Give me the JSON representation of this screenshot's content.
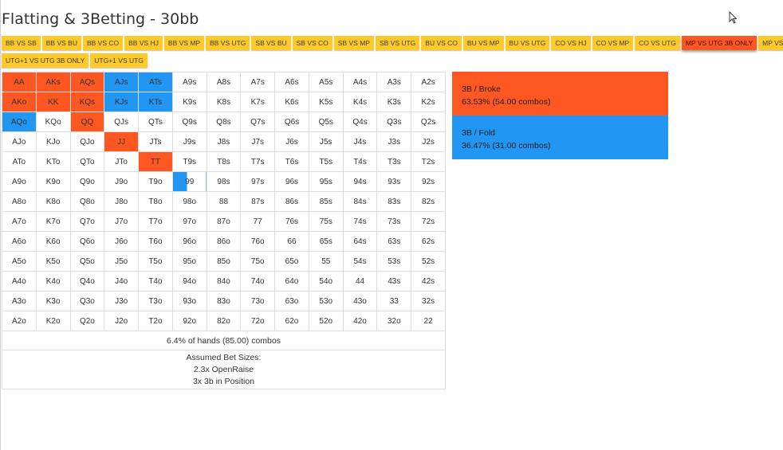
{
  "page": {
    "title": "Flatting & 3Betting - 30bb"
  },
  "tabs": {
    "row1": [
      "BB VS SB",
      "BB VS BU",
      "BB VS CO",
      "BB VS HJ",
      "BB VS MP",
      "BB VS UTG",
      "SB VS BU",
      "SB VS CO",
      "SB VS MP",
      "SB VS UTG",
      "BU VS CO",
      "BU VS MP",
      "BU VS UTG",
      "CO VS HJ",
      "CO VS MP",
      "CO VS UTG",
      "MP VS UTG 3B ONLY",
      "MP VS UTG"
    ],
    "row2": [
      "UTG+1 VS UTG 3B ONLY",
      "UTG+1 VS UTG"
    ],
    "active": "MP VS UTG 3B ONLY"
  },
  "colors": {
    "red": "#ff5722",
    "blue": "#2196f3",
    "tab": "#ffca28",
    "active_tab": "#ff5722"
  },
  "grid": [
    [
      "AA",
      "AKs",
      "AQs",
      "AJs",
      "ATs",
      "A9s",
      "A8s",
      "A7s",
      "A6s",
      "A5s",
      "A4s",
      "A3s",
      "A2s"
    ],
    [
      "AKo",
      "KK",
      "KQs",
      "KJs",
      "KTs",
      "K9s",
      "K8s",
      "K7s",
      "K6s",
      "K5s",
      "K4s",
      "K3s",
      "K2s"
    ],
    [
      "AQo",
      "KQo",
      "QQ",
      "QJs",
      "QTs",
      "Q9s",
      "Q8s",
      "Q7s",
      "Q6s",
      "Q5s",
      "Q4s",
      "Q3s",
      "Q2s"
    ],
    [
      "AJo",
      "KJo",
      "QJo",
      "JJ",
      "JTs",
      "J9s",
      "J8s",
      "J7s",
      "J6s",
      "J5s",
      "J4s",
      "J3s",
      "J2s"
    ],
    [
      "ATo",
      "KTo",
      "QTo",
      "JTo",
      "TT",
      "T9s",
      "T8s",
      "T7s",
      "T6s",
      "T5s",
      "T4s",
      "T3s",
      "T2s"
    ],
    [
      "A9o",
      "K9o",
      "Q9o",
      "J9o",
      "T9o",
      "99",
      "98s",
      "97s",
      "96s",
      "95s",
      "94s",
      "93s",
      "92s"
    ],
    [
      "A8o",
      "K8o",
      "Q8o",
      "J8o",
      "T8o",
      "98o",
      "88",
      "87s",
      "86s",
      "85s",
      "84s",
      "83s",
      "82s"
    ],
    [
      "A7o",
      "K7o",
      "Q7o",
      "J7o",
      "T7o",
      "97o",
      "87o",
      "77",
      "76s",
      "75s",
      "74s",
      "73s",
      "72s"
    ],
    [
      "A6o",
      "K6o",
      "Q6o",
      "J6o",
      "T6o",
      "96o",
      "86o",
      "76o",
      "66",
      "65s",
      "64s",
      "63s",
      "62s"
    ],
    [
      "A5o",
      "K5o",
      "Q5o",
      "J5o",
      "T5o",
      "95o",
      "85o",
      "75o",
      "65o",
      "55",
      "54s",
      "53s",
      "52s"
    ],
    [
      "A4o",
      "K4o",
      "Q4o",
      "J4o",
      "T4o",
      "94o",
      "84o",
      "74o",
      "64o",
      "54o",
      "44",
      "43s",
      "42s"
    ],
    [
      "A3o",
      "K3o",
      "Q3o",
      "J3o",
      "T3o",
      "93o",
      "83o",
      "73o",
      "63o",
      "53o",
      "43o",
      "33",
      "32s"
    ],
    [
      "A2o",
      "K2o",
      "Q2o",
      "J2o",
      "T2o",
      "92o",
      "82o",
      "72o",
      "62o",
      "52o",
      "42o",
      "32o",
      "22"
    ]
  ],
  "cell_actions": {
    "AA": "red",
    "AKs": "red",
    "AQs": "red",
    "AJs": "blue",
    "ATs": "blue",
    "AKo": "red",
    "KK": "red",
    "KQs": "red",
    "KJs": "blue",
    "KTs": "blue",
    "AQo": "blue",
    "QQ": "red",
    "JJ": "red",
    "TT": "red",
    "99": "half-blue"
  },
  "summary": "6.4% of hands (85.00) combos",
  "bet_sizes": {
    "heading": "Assumed Bet Sizes:",
    "line1": "2.3x OpenRaise",
    "line2": "3x 3b in Position"
  },
  "legend": [
    {
      "label": "3B / Broke",
      "stats": "63.53% (54.00 combos)",
      "color": "red"
    },
    {
      "label": "3B / Fold",
      "stats": "36.47% (31.00 combos)",
      "color": "blue"
    }
  ]
}
